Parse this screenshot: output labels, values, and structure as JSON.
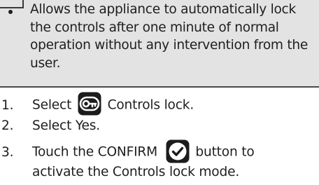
{
  "note": {
    "text": "Allows the appliance to automatically lock the controls after one minute of normal operation without any intervention from the user."
  },
  "steps": [
    {
      "number": "1.",
      "before": "Select",
      "icon": "key-lock-icon",
      "after": "Controls lock."
    },
    {
      "number": "2.",
      "text": "Select Yes."
    },
    {
      "number": "3.",
      "before": "Touch the CONFIRM",
      "icon": "checkmark-icon",
      "after": "button to",
      "continuation": "activate the Controls lock mode."
    }
  ]
}
